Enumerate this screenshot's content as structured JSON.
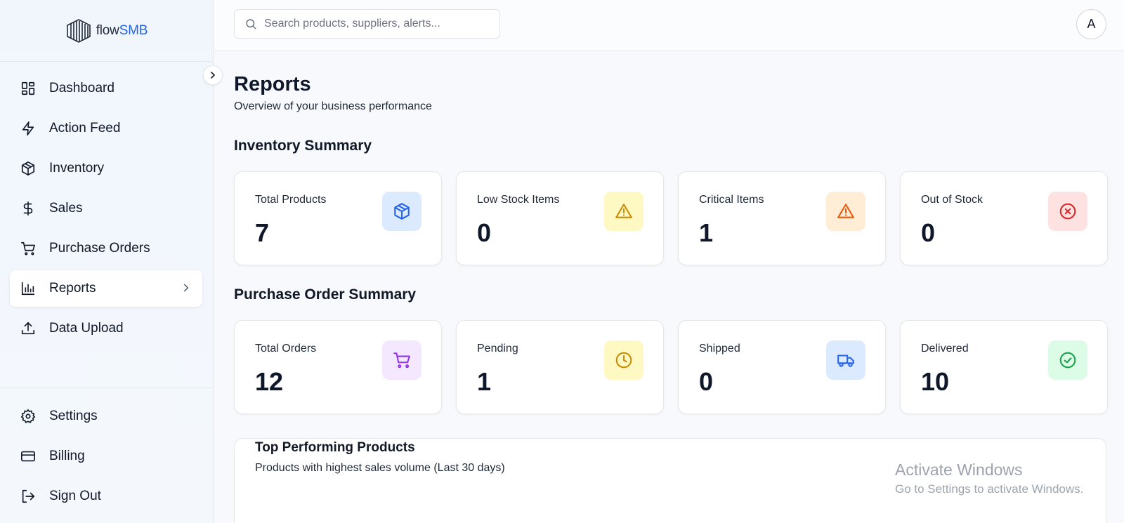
{
  "brand": {
    "name_prefix": "flow",
    "name_suffix": "SMB"
  },
  "search": {
    "placeholder": "Search products, suppliers, alerts..."
  },
  "user": {
    "avatar_initial": "A"
  },
  "sidebar": {
    "items": [
      {
        "label": "Dashboard",
        "icon": "dashboard-icon"
      },
      {
        "label": "Action Feed",
        "icon": "lightning-icon"
      },
      {
        "label": "Inventory",
        "icon": "package-icon"
      },
      {
        "label": "Sales",
        "icon": "dollar-icon"
      },
      {
        "label": "Purchase Orders",
        "icon": "cart-icon"
      },
      {
        "label": "Reports",
        "icon": "bar-chart-icon",
        "active": true
      },
      {
        "label": "Data Upload",
        "icon": "upload-icon"
      }
    ],
    "bottom_items": [
      {
        "label": "Settings",
        "icon": "gear-icon"
      },
      {
        "label": "Billing",
        "icon": "credit-card-icon"
      },
      {
        "label": "Sign Out",
        "icon": "sign-out-icon"
      }
    ]
  },
  "page": {
    "title": "Reports",
    "subtitle": "Overview of your business performance"
  },
  "inventory_summary": {
    "title": "Inventory Summary",
    "cards": [
      {
        "label": "Total Products",
        "value": "7",
        "icon": "package-icon",
        "color": "#2563eb",
        "bg": "#dbeafe"
      },
      {
        "label": "Low Stock Items",
        "value": "0",
        "icon": "warning-icon",
        "color": "#ca8a04",
        "bg": "#fef9c3"
      },
      {
        "label": "Critical Items",
        "value": "1",
        "icon": "warning-icon",
        "color": "#ea580c",
        "bg": "#ffedd5"
      },
      {
        "label": "Out of Stock",
        "value": "0",
        "icon": "x-circle-icon",
        "color": "#dc2626",
        "bg": "#fee2e2"
      }
    ]
  },
  "purchase_order_summary": {
    "title": "Purchase Order Summary",
    "cards": [
      {
        "label": "Total Orders",
        "value": "12",
        "icon": "cart-icon",
        "color": "#9333ea",
        "bg": "#f3e8ff"
      },
      {
        "label": "Pending",
        "value": "1",
        "icon": "clock-icon",
        "color": "#ca8a04",
        "bg": "#fef9c3"
      },
      {
        "label": "Shipped",
        "value": "0",
        "icon": "truck-icon",
        "color": "#2563eb",
        "bg": "#dbeafe"
      },
      {
        "label": "Delivered",
        "value": "10",
        "icon": "check-circle-icon",
        "color": "#16a34a",
        "bg": "#dcfce7"
      }
    ]
  },
  "top_products": {
    "title": "Top Performing Products",
    "subtitle": "Products with highest sales volume (Last 30 days)"
  },
  "watermark": {
    "line1": "Activate Windows",
    "line2": "Go to Settings to activate Windows."
  }
}
